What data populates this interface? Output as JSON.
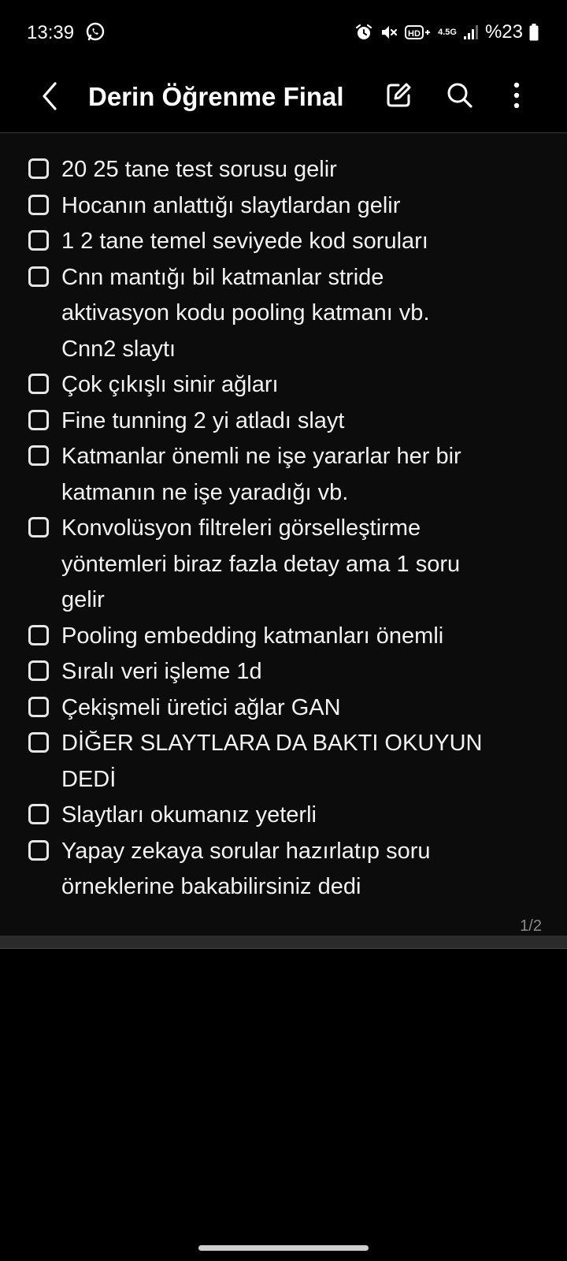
{
  "status_bar": {
    "time": "13:39",
    "network_label": "4.5G",
    "battery_text": "%23",
    "icons": [
      "whatsapp-icon",
      "alarm-icon",
      "mute-icon",
      "hd-voice-icon",
      "signal-icon",
      "battery-icon"
    ]
  },
  "app_bar": {
    "title": "Derin Öğrenme Final",
    "icons": [
      "back-arrow-icon",
      "edit-icon",
      "search-icon",
      "more-vertical-icon"
    ]
  },
  "checklist": [
    {
      "text": "20 25 tane test sorusu gelir",
      "checked": false
    },
    {
      "text": "Hocanın anlattığı slaytlardan gelir",
      "checked": false
    },
    {
      "text": "1 2 tane temel seviyede kod soruları",
      "checked": false
    },
    {
      "text": "Cnn mantığı bil katmanlar stride\naktivasyon kodu pooling katmanı vb.\nCnn2 slaytı",
      "checked": false
    },
    {
      "text": "Çok çıkışlı sinir ağları",
      "checked": false
    },
    {
      "text": "Fine tunning 2 yi atladı slayt",
      "checked": false
    },
    {
      "text": "Katmanlar önemli ne işe yararlar her bir\nkatmanın ne işe yaradığı vb.",
      "checked": false
    },
    {
      "text": "Konvolüsyon filtreleri görselleştirme\nyöntemleri biraz fazla detay ama 1 soru\ngelir",
      "checked": false
    },
    {
      "text": "Pooling embedding katmanları önemli",
      "checked": false
    },
    {
      "text": "Sıralı veri işleme 1d",
      "checked": false
    },
    {
      "text": "Çekişmeli üretici ağlar GAN",
      "checked": false
    },
    {
      "text": "DİĞER SLAYTLARA DA BAKTI OKUYUN\nDEDİ",
      "checked": false
    },
    {
      "text": "Slaytları okumanız yeterli",
      "checked": false
    },
    {
      "text": "Yapay zekaya sorular hazırlatıp soru\nörneklerine bakabilirsiniz dedi",
      "checked": false
    }
  ],
  "page_indicator": "1/2",
  "colors": {
    "background": "#000000",
    "page_background": "#0c0c0c",
    "text": "#f2f2f2",
    "muted_text": "#8a8a8a"
  }
}
